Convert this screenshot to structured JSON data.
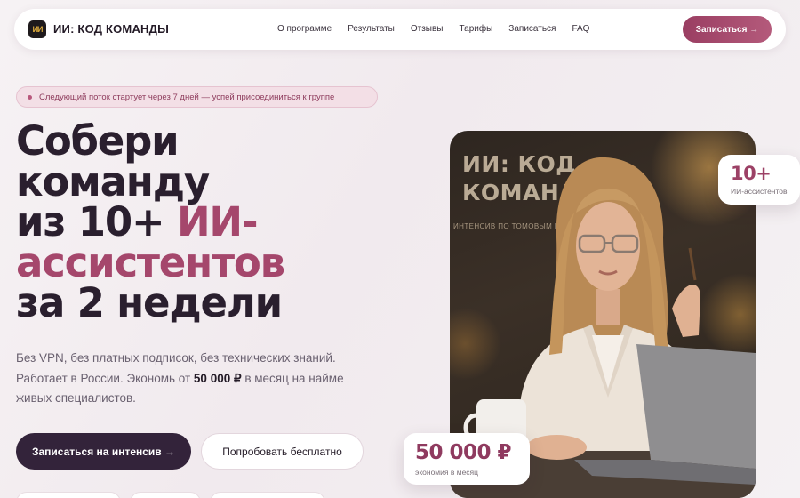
{
  "brand": {
    "logo_mark": "ИИ",
    "name": "ИИ: КОД КОМАНДЫ"
  },
  "nav": {
    "links": [
      "О программе",
      "Результаты",
      "Отзывы",
      "Тарифы",
      "Записаться",
      "FAQ"
    ],
    "cta": "Записаться →"
  },
  "badge": {
    "text": "Следующий поток стартует через 7 дней — успей присоединиться к группе"
  },
  "hero": {
    "title_line1": "Собери",
    "title_line2": "команду",
    "title_line3_a": "из 10+ ",
    "title_line3_b": "ИИ-",
    "title_line4": "ассистентов",
    "title_line5": "за 2 недели",
    "sub_a": "Без VPN, без платных подписок, без технических знаний. Работает в России. Экономь от ",
    "sub_b": "50 000 ₽",
    "sub_c": " в месяц на найме живых специалистов."
  },
  "buttons": {
    "primary": "Записаться на интенсив →",
    "secondary": "Попробовать бесплатно"
  },
  "photo": {
    "sign_title": "ИИ: КОД КОМАНДЫ",
    "sign_sub": "ИНТЕНСИВ ПО ТОМОВЫМ НЕЙРОСЕТЯМ"
  },
  "stats": [
    {
      "value": "10+",
      "label": "ИИ-ассистентов"
    },
    {
      "value": "50 000 ₽",
      "label": "экономия в месяц"
    }
  ],
  "colors": {
    "accent": "#a5476c",
    "dark": "#33233a",
    "badge_bg": "#f3dfe6"
  }
}
